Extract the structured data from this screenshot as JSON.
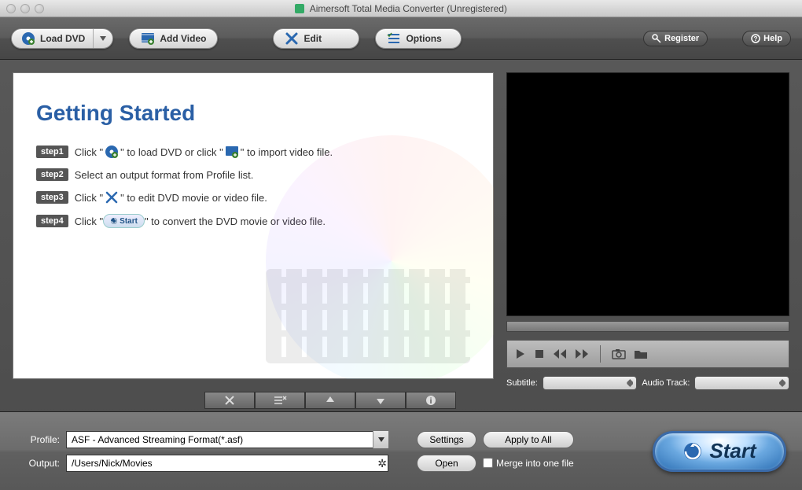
{
  "window": {
    "title": "Aimersoft Total Media Converter (Unregistered)"
  },
  "toolbar": {
    "loadDVD": "Load DVD",
    "addVideo": "Add Video",
    "edit": "Edit",
    "options": "Options",
    "register": "Register",
    "help": "Help"
  },
  "gettingStarted": {
    "title": "Getting Started",
    "steps": [
      {
        "tag": "step1",
        "pre": "Click \"",
        "mid": "\" to load DVD or click \"",
        "post": "\" to import video file."
      },
      {
        "tag": "step2",
        "text": "Select an output format from Profile list."
      },
      {
        "tag": "step3",
        "pre": "Click \"",
        "post": "\" to edit DVD movie or video file."
      },
      {
        "tag": "step4",
        "pre": "Click \"",
        "pill": "Start",
        "post": "\" to convert the DVD movie or video file."
      }
    ]
  },
  "subtitle": {
    "label": "Subtitle:",
    "audioLabel": "Audio Track:"
  },
  "bottom": {
    "profileLabel": "Profile:",
    "profileValue": "ASF - Advanced Streaming Format(*.asf)",
    "outputLabel": "Output:",
    "outputValue": "/Users/Nick/Movies",
    "settings": "Settings",
    "applyAll": "Apply to All",
    "open": "Open",
    "merge": "Merge into one file",
    "start": "Start"
  }
}
